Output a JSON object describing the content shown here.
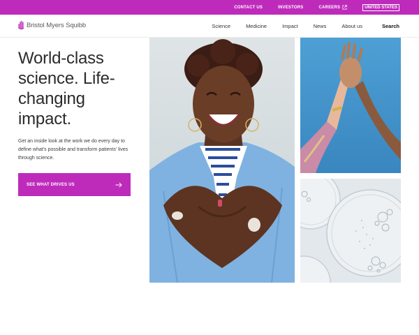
{
  "utility_nav": {
    "contact": "CONTACT US",
    "investors": "INVESTORS",
    "careers": "CAREERS",
    "region": "UNITED STATES"
  },
  "header": {
    "logo_text": "Bristol Myers Squibb",
    "nav": [
      "Science",
      "Medicine",
      "Impact",
      "News",
      "About us"
    ],
    "search": "Search"
  },
  "hero": {
    "title_lines": [
      "World-class",
      "science. Life-",
      "changing",
      "impact."
    ],
    "description": "Get an inside look at the work we do every day to define what's possible and transform patients' lives through science.",
    "cta_label": "SEE WHAT DRIVES US"
  },
  "colors": {
    "brand_magenta": "#be2bbb",
    "text_dark": "#2b2b2b"
  },
  "icons": {
    "careers": "external-link-icon",
    "cta": "arrow-right-icon",
    "logo": "hand-logo-icon"
  }
}
